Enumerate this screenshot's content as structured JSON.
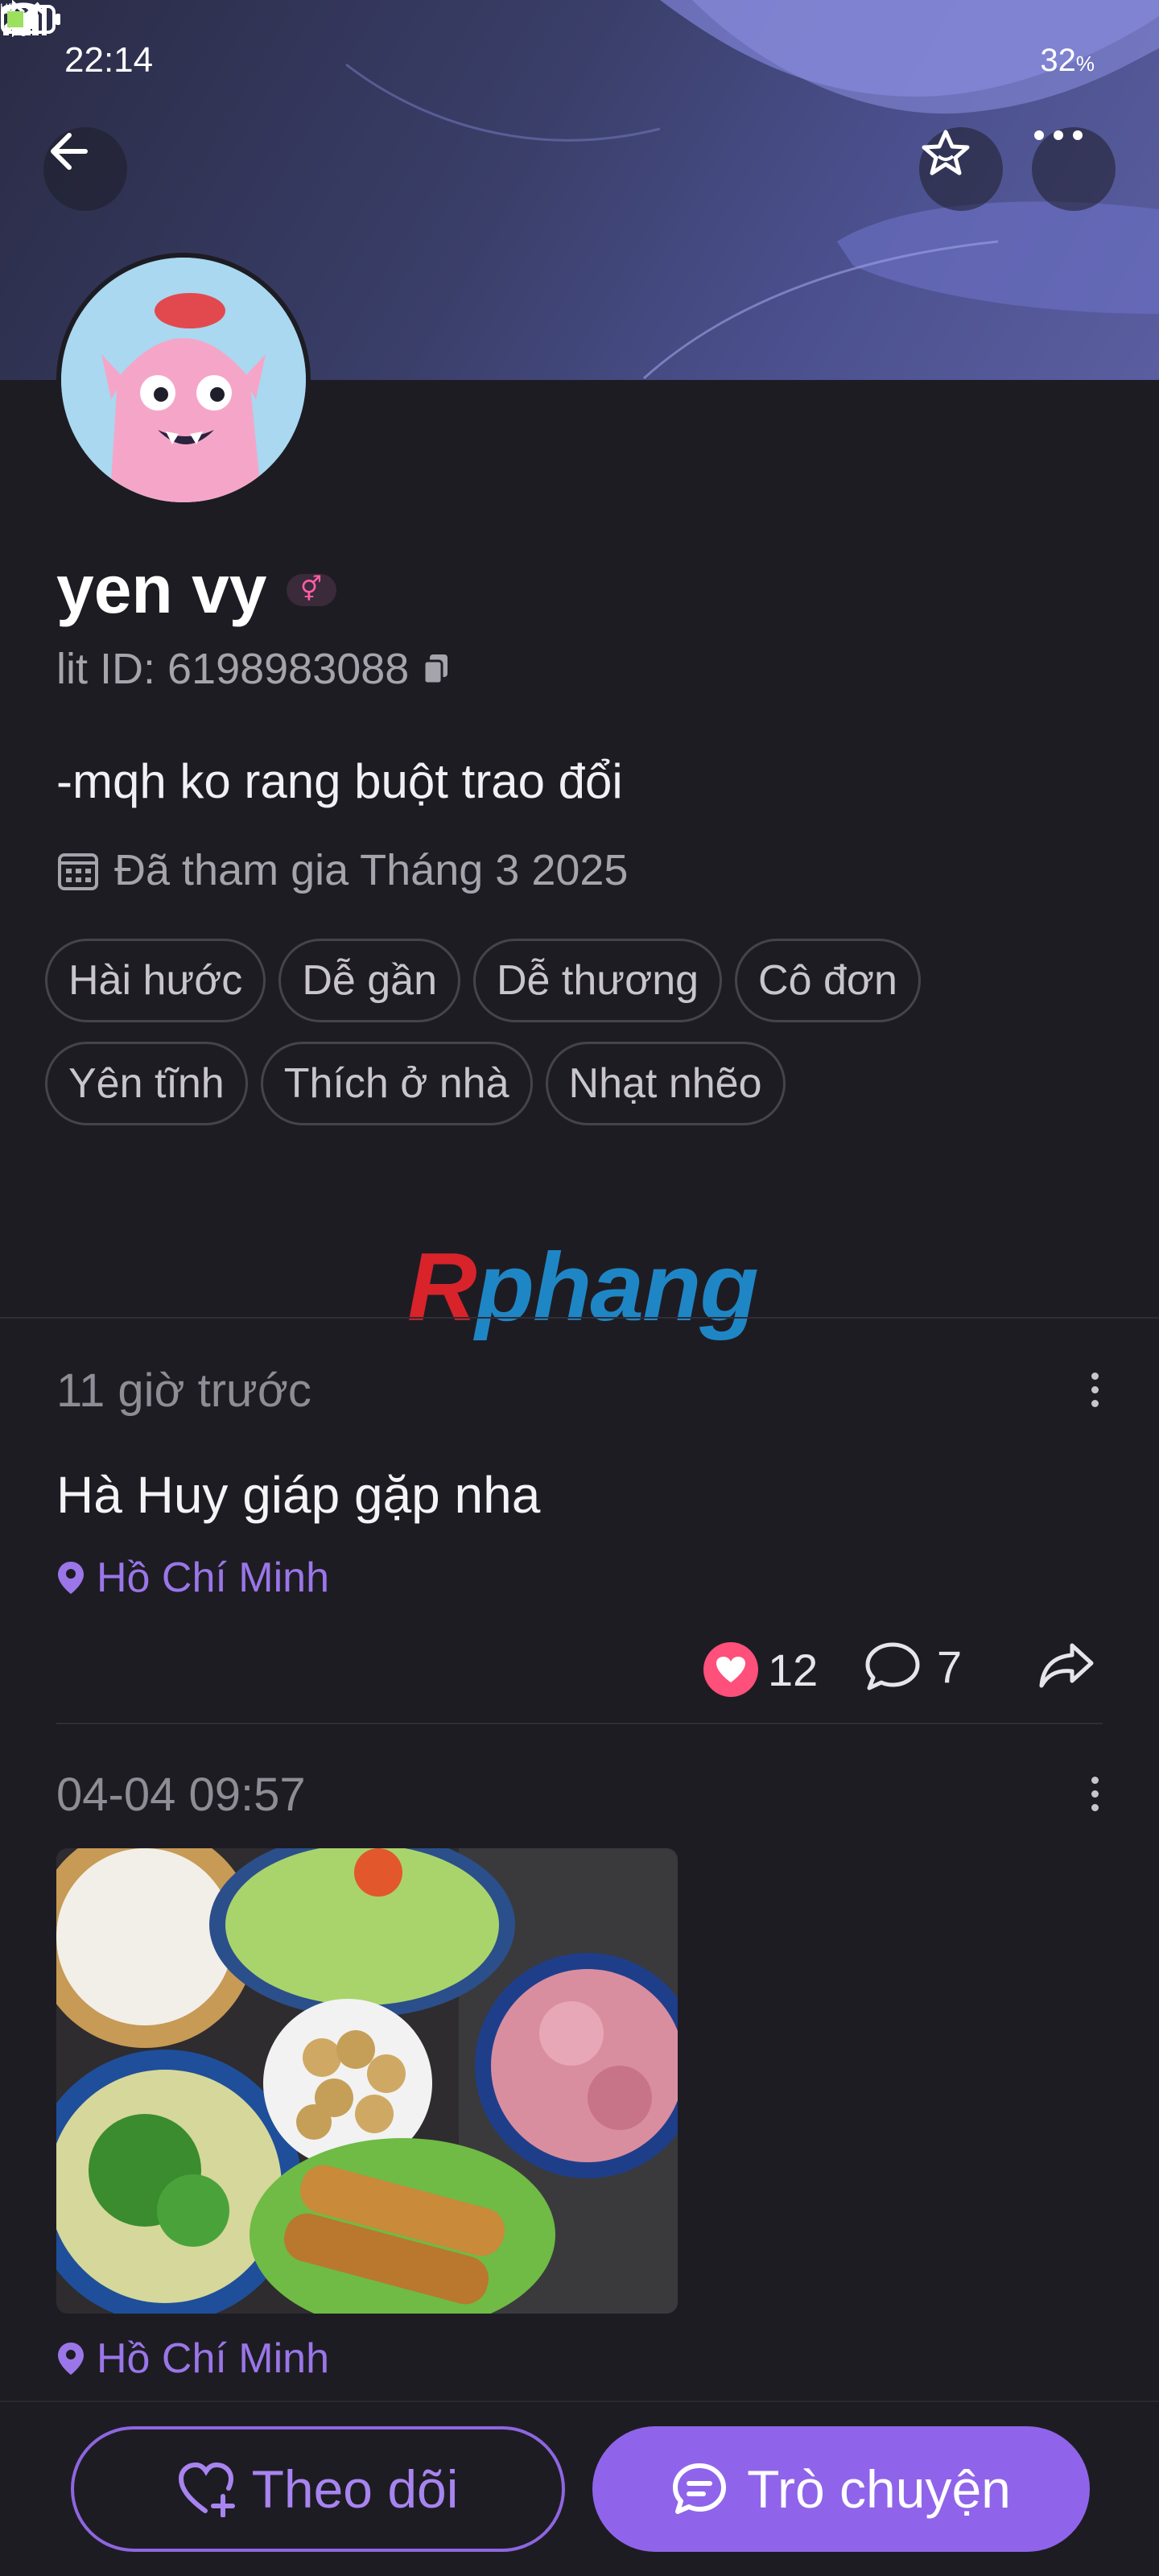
{
  "status_bar": {
    "time": "22:14",
    "battery": "32",
    "battery_unit": "%"
  },
  "profile": {
    "name": "yen vy",
    "gender_symbol": "⚥",
    "lit_id": "lit ID: 6198983088",
    "bio": "-mqh ko rang buột trao đổi",
    "joined": "Đã tham gia Tháng 3 2025",
    "tags": [
      "Hài hước",
      "Dễ gần",
      "Dễ thương",
      "Cô đơn",
      "Yên tĩnh",
      "Thích ở nhà",
      "Nhạt nhẽo"
    ]
  },
  "watermark": {
    "first": "R",
    "rest": "phang"
  },
  "posts": [
    {
      "time": "11 giờ trước",
      "text": "Hà Huy giáp gặp nha",
      "location": "Hồ Chí Minh",
      "likes": "12",
      "comments": "7"
    },
    {
      "time": "04-04 09:57",
      "location": "Hồ Chí Minh"
    }
  ],
  "bottom": {
    "follow_label": "Theo dõi",
    "chat_label": "Trò chuyện"
  },
  "colors": {
    "accent": "#8f64ea",
    "like": "#ff4f7b",
    "location": "#9a76e8",
    "background": "#1e1c23"
  },
  "icons": {
    "back": "back-arrow-icon",
    "star": "star-icon",
    "more": "more-horizontal-icon",
    "copy": "copy-icon",
    "calendar": "calendar-icon",
    "location": "location-pin-icon",
    "heart": "heart-icon",
    "comment": "comment-icon",
    "share": "share-icon",
    "follow": "heart-plus-icon",
    "chat": "chat-bubble-icon"
  }
}
